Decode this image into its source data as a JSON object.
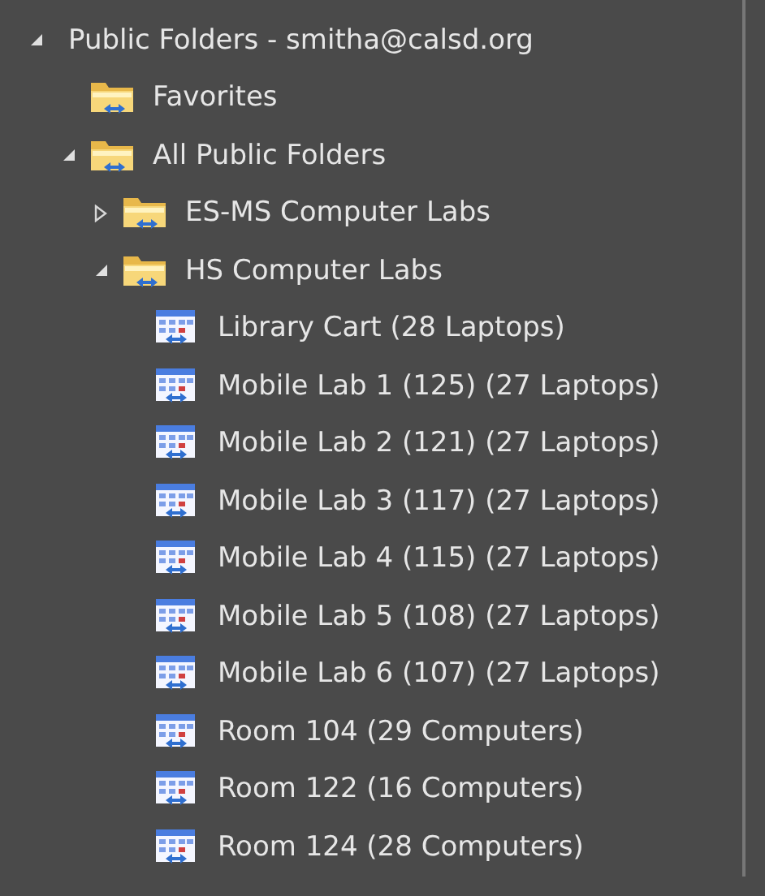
{
  "tree": {
    "label": "Public Folders - smitha@calsd.org",
    "expanded": true,
    "children": [
      {
        "label": "Favorites",
        "kind": "folder"
      },
      {
        "label": "All Public Folders",
        "kind": "folder",
        "expanded": true,
        "children": [
          {
            "label": "ES-MS Computer Labs",
            "kind": "folder",
            "expanded": false
          },
          {
            "label": "HS Computer Labs",
            "kind": "folder",
            "expanded": true,
            "children": [
              {
                "label": "Library Cart (28 Laptops)",
                "kind": "calendar"
              },
              {
                "label": "Mobile Lab 1 (125) (27 Laptops)",
                "kind": "calendar"
              },
              {
                "label": "Mobile Lab 2 (121) (27 Laptops)",
                "kind": "calendar"
              },
              {
                "label": "Mobile Lab 3 (117) (27 Laptops)",
                "kind": "calendar"
              },
              {
                "label": "Mobile Lab 4 (115) (27 Laptops)",
                "kind": "calendar"
              },
              {
                "label": "Mobile Lab 5 (108) (27 Laptops)",
                "kind": "calendar"
              },
              {
                "label": "Mobile Lab 6 (107) (27 Laptops)",
                "kind": "calendar"
              },
              {
                "label": "Room 104 (29 Computers)",
                "kind": "calendar"
              },
              {
                "label": "Room 122 (16 Computers)",
                "kind": "calendar"
              },
              {
                "label": "Room 124 (28 Computers)",
                "kind": "calendar"
              }
            ]
          }
        ]
      }
    ]
  }
}
